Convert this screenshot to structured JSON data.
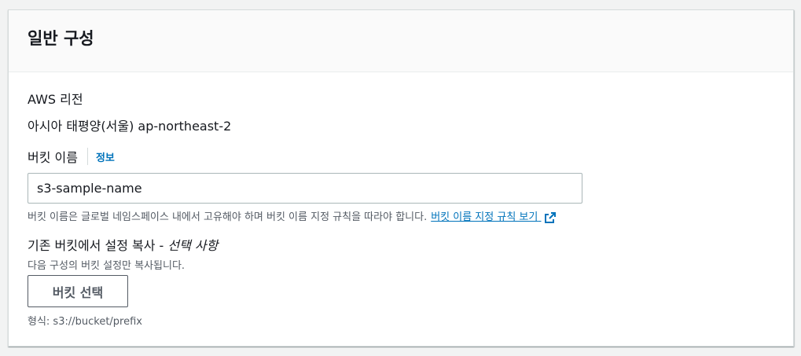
{
  "panel": {
    "title": "일반 구성"
  },
  "region": {
    "label": "AWS 리전",
    "value": "아시아 태평양(서울) ap-northeast-2"
  },
  "bucket_name": {
    "label": "버킷 이름",
    "info_link": "정보",
    "value": "s3-sample-name",
    "hint": "버킷 이름은 글로벌 네임스페이스 내에서 고유해야 하며 버킷 이름 지정 규칙을 따라야 합니다.",
    "rules_link": "버킷 이름 지정 규칙 보기",
    "rules_link_icon": "external-link-icon"
  },
  "copy_settings": {
    "label": "기존 버킷에서 설정 복사 - ",
    "optional": "선택 사항",
    "hint": "다음 구성의 버킷 설정만 복사됩니다.",
    "button_label": "버킷 선택",
    "format_hint": "형식: s3://bucket/prefix"
  },
  "colors": {
    "link": "#0073bb",
    "text": "#16191f",
    "secondary_text": "#545b64",
    "border": "#aab7b8"
  }
}
